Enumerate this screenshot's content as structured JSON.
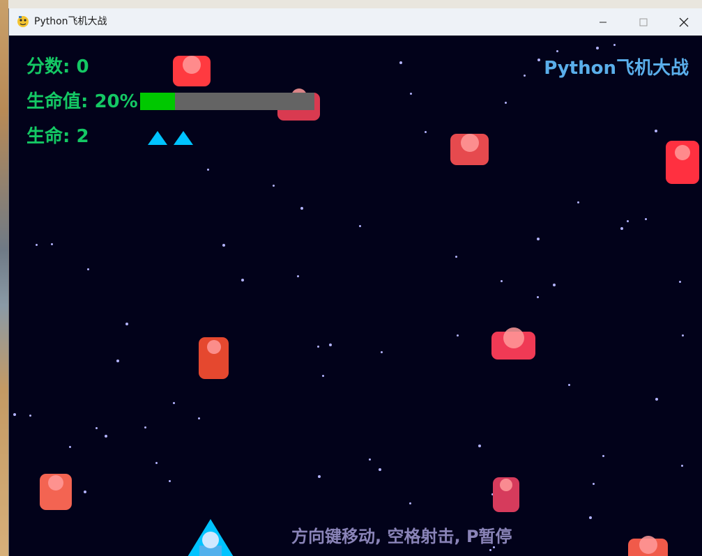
{
  "window": {
    "title": "Python飞机大战",
    "icon": "pygame-snake-icon",
    "controls": [
      "minimize-icon",
      "maximize-icon",
      "close-icon"
    ]
  },
  "hud": {
    "score_label": "分数",
    "score_value": "0",
    "score_text": "分数: 0",
    "health_text": "生命值: 20%",
    "health_percent": 20,
    "lives_text": "生命: 2",
    "lives_count": 2,
    "brand_text": "Python飞机大战"
  },
  "footer": {
    "hint_text": "方向键移动, 空格射击, P暂停"
  },
  "colors": {
    "background": "#02021a",
    "hud_green": "#14c864",
    "brand_blue": "#5aaeea",
    "health_fill": "#00c800",
    "health_track": "#646464",
    "player_cyan": "#00c3ff",
    "star": "#b3b3ff"
  }
}
